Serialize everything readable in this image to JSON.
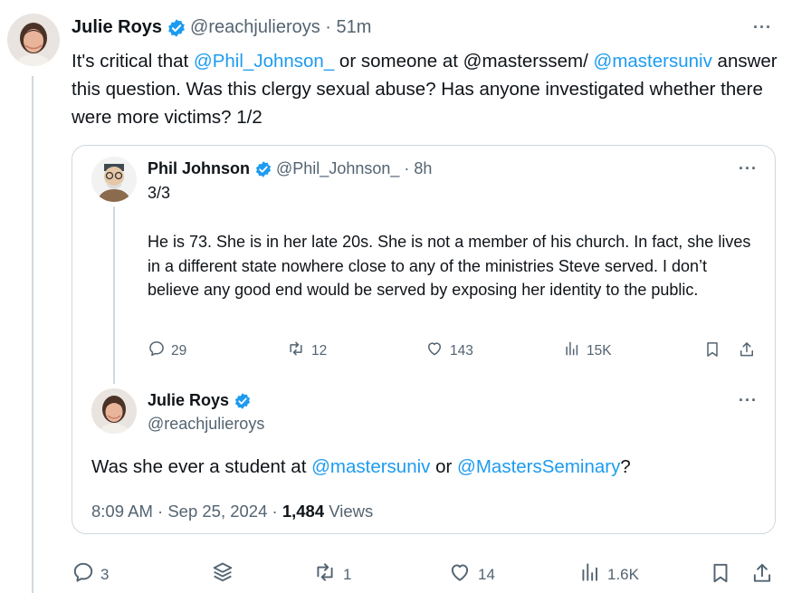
{
  "main_tweet": {
    "author_name": "Julie Roys",
    "handle": "@reachjulieroys",
    "separator": " · ",
    "time": "51m",
    "text": {
      "part1": "It's critical that ",
      "mention1": "@Phil_Johnson_",
      "part2": " or someone at @masterssem/ ",
      "mention2": "@mastersuniv",
      "part3": " answer this question. Was this clergy sexual abuse? Has anyone investigated whether there were more victims?  1/2"
    },
    "more_label": "···",
    "actions": {
      "replies": "3",
      "reposts": "1",
      "likes": "14",
      "views": "1.6K"
    }
  },
  "quoted_thread": {
    "parent": {
      "author_name": "Phil Johnson",
      "handle": "@Phil_Johnson_",
      "separator": " · ",
      "time": "8h",
      "count": "3/3",
      "text": "He is 73. She is in her late 20s. She is not a member of his church. In fact, she lives in a different state nowhere close to any of the ministries Steve served. I don’t believe any good end would be served by exposing her identity to the public.",
      "more_label": "···",
      "actions": {
        "replies": "29",
        "reposts": "12",
        "likes": "143",
        "views": "15K"
      }
    },
    "reply": {
      "author_name": "Julie Roys",
      "handle": "@reachjulieroys",
      "more_label": "···",
      "text": {
        "part1": "Was she ever a student at ",
        "mention1": "@mastersuniv",
        "part2": " or ",
        "mention2": "@MastersSeminary",
        "part3": "?"
      },
      "meta": {
        "time": "8:09 AM · Sep 25, 2024 · ",
        "views_count": "1,484",
        "views_label": " Views"
      }
    }
  },
  "colors": {
    "accent": "#1d9bf0",
    "text": "#0f1419",
    "muted": "#536471",
    "border": "#cfd9de"
  },
  "icons": [
    "verified-badge-icon",
    "more-icon",
    "reply-icon",
    "repost-icon",
    "like-icon",
    "views-icon",
    "bookmark-icon",
    "share-icon",
    "grok-icon"
  ]
}
